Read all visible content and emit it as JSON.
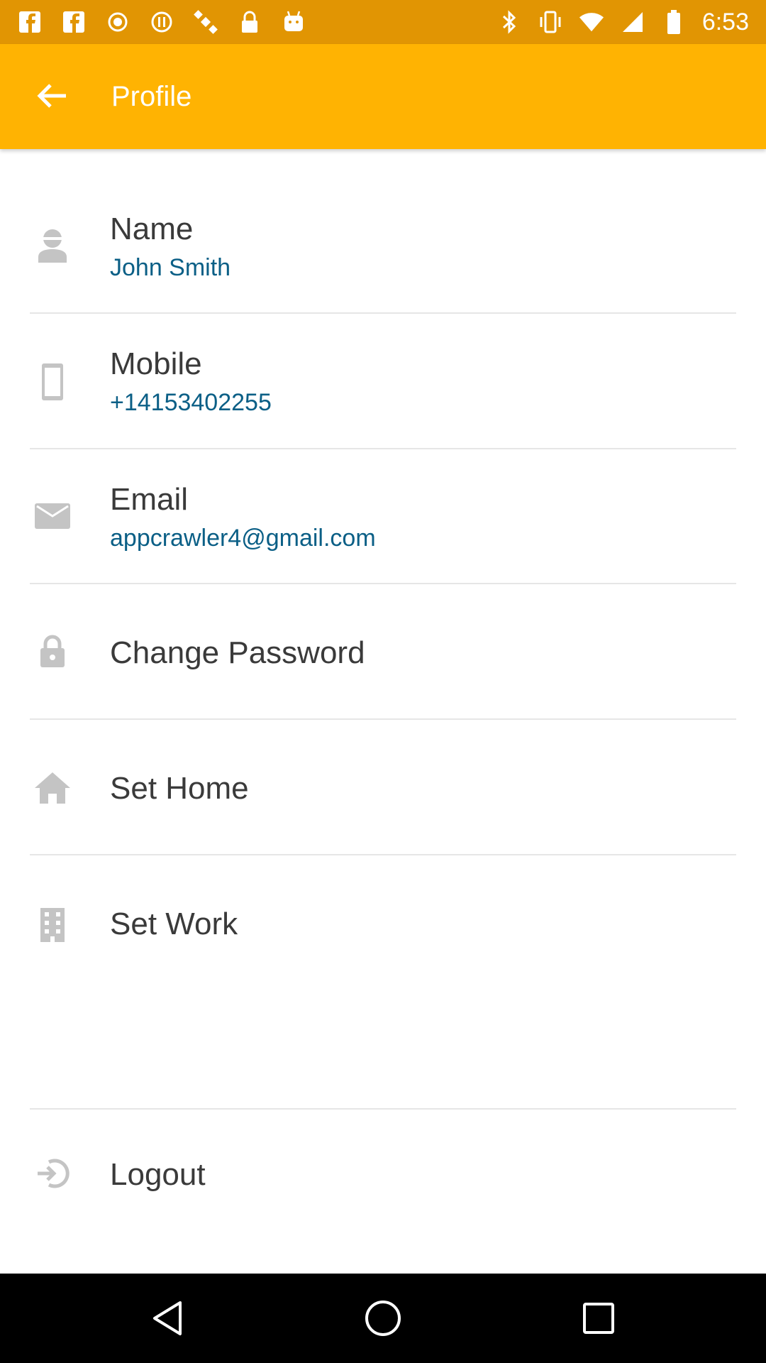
{
  "status_bar": {
    "time": "6:53",
    "left_icons": [
      "facebook-icon",
      "facebook-icon",
      "fake-gps-icon",
      "record-icon",
      "record-icon",
      "satellite-icon",
      "lock-icon",
      "android-icon"
    ],
    "right_icons": [
      "bluetooth-icon",
      "vibrate-icon",
      "wifi-icon",
      "signal-icon",
      "battery-icon"
    ]
  },
  "toolbar": {
    "title": "Profile",
    "background": "#ffb302"
  },
  "profile": {
    "name": {
      "label": "Name",
      "value": "John Smith",
      "icon": "person-icon"
    },
    "mobile": {
      "label": "Mobile",
      "value": "+14153402255",
      "icon": "phone-icon"
    },
    "email": {
      "label": "Email",
      "value": "appcrawler4@gmail.com",
      "icon": "mail-icon"
    }
  },
  "actions": {
    "change_password": {
      "label": "Change Password",
      "icon": "lock-icon"
    },
    "set_home": {
      "label": "Set Home",
      "icon": "home-icon"
    },
    "set_work": {
      "label": "Set Work",
      "icon": "building-icon"
    },
    "logout": {
      "label": "Logout",
      "icon": "logout-icon"
    }
  },
  "colors": {
    "accent": "#ffb302",
    "status_bar": "#e19503",
    "value_text": "#0b5f86",
    "icon_gray": "#bdbdbd"
  }
}
